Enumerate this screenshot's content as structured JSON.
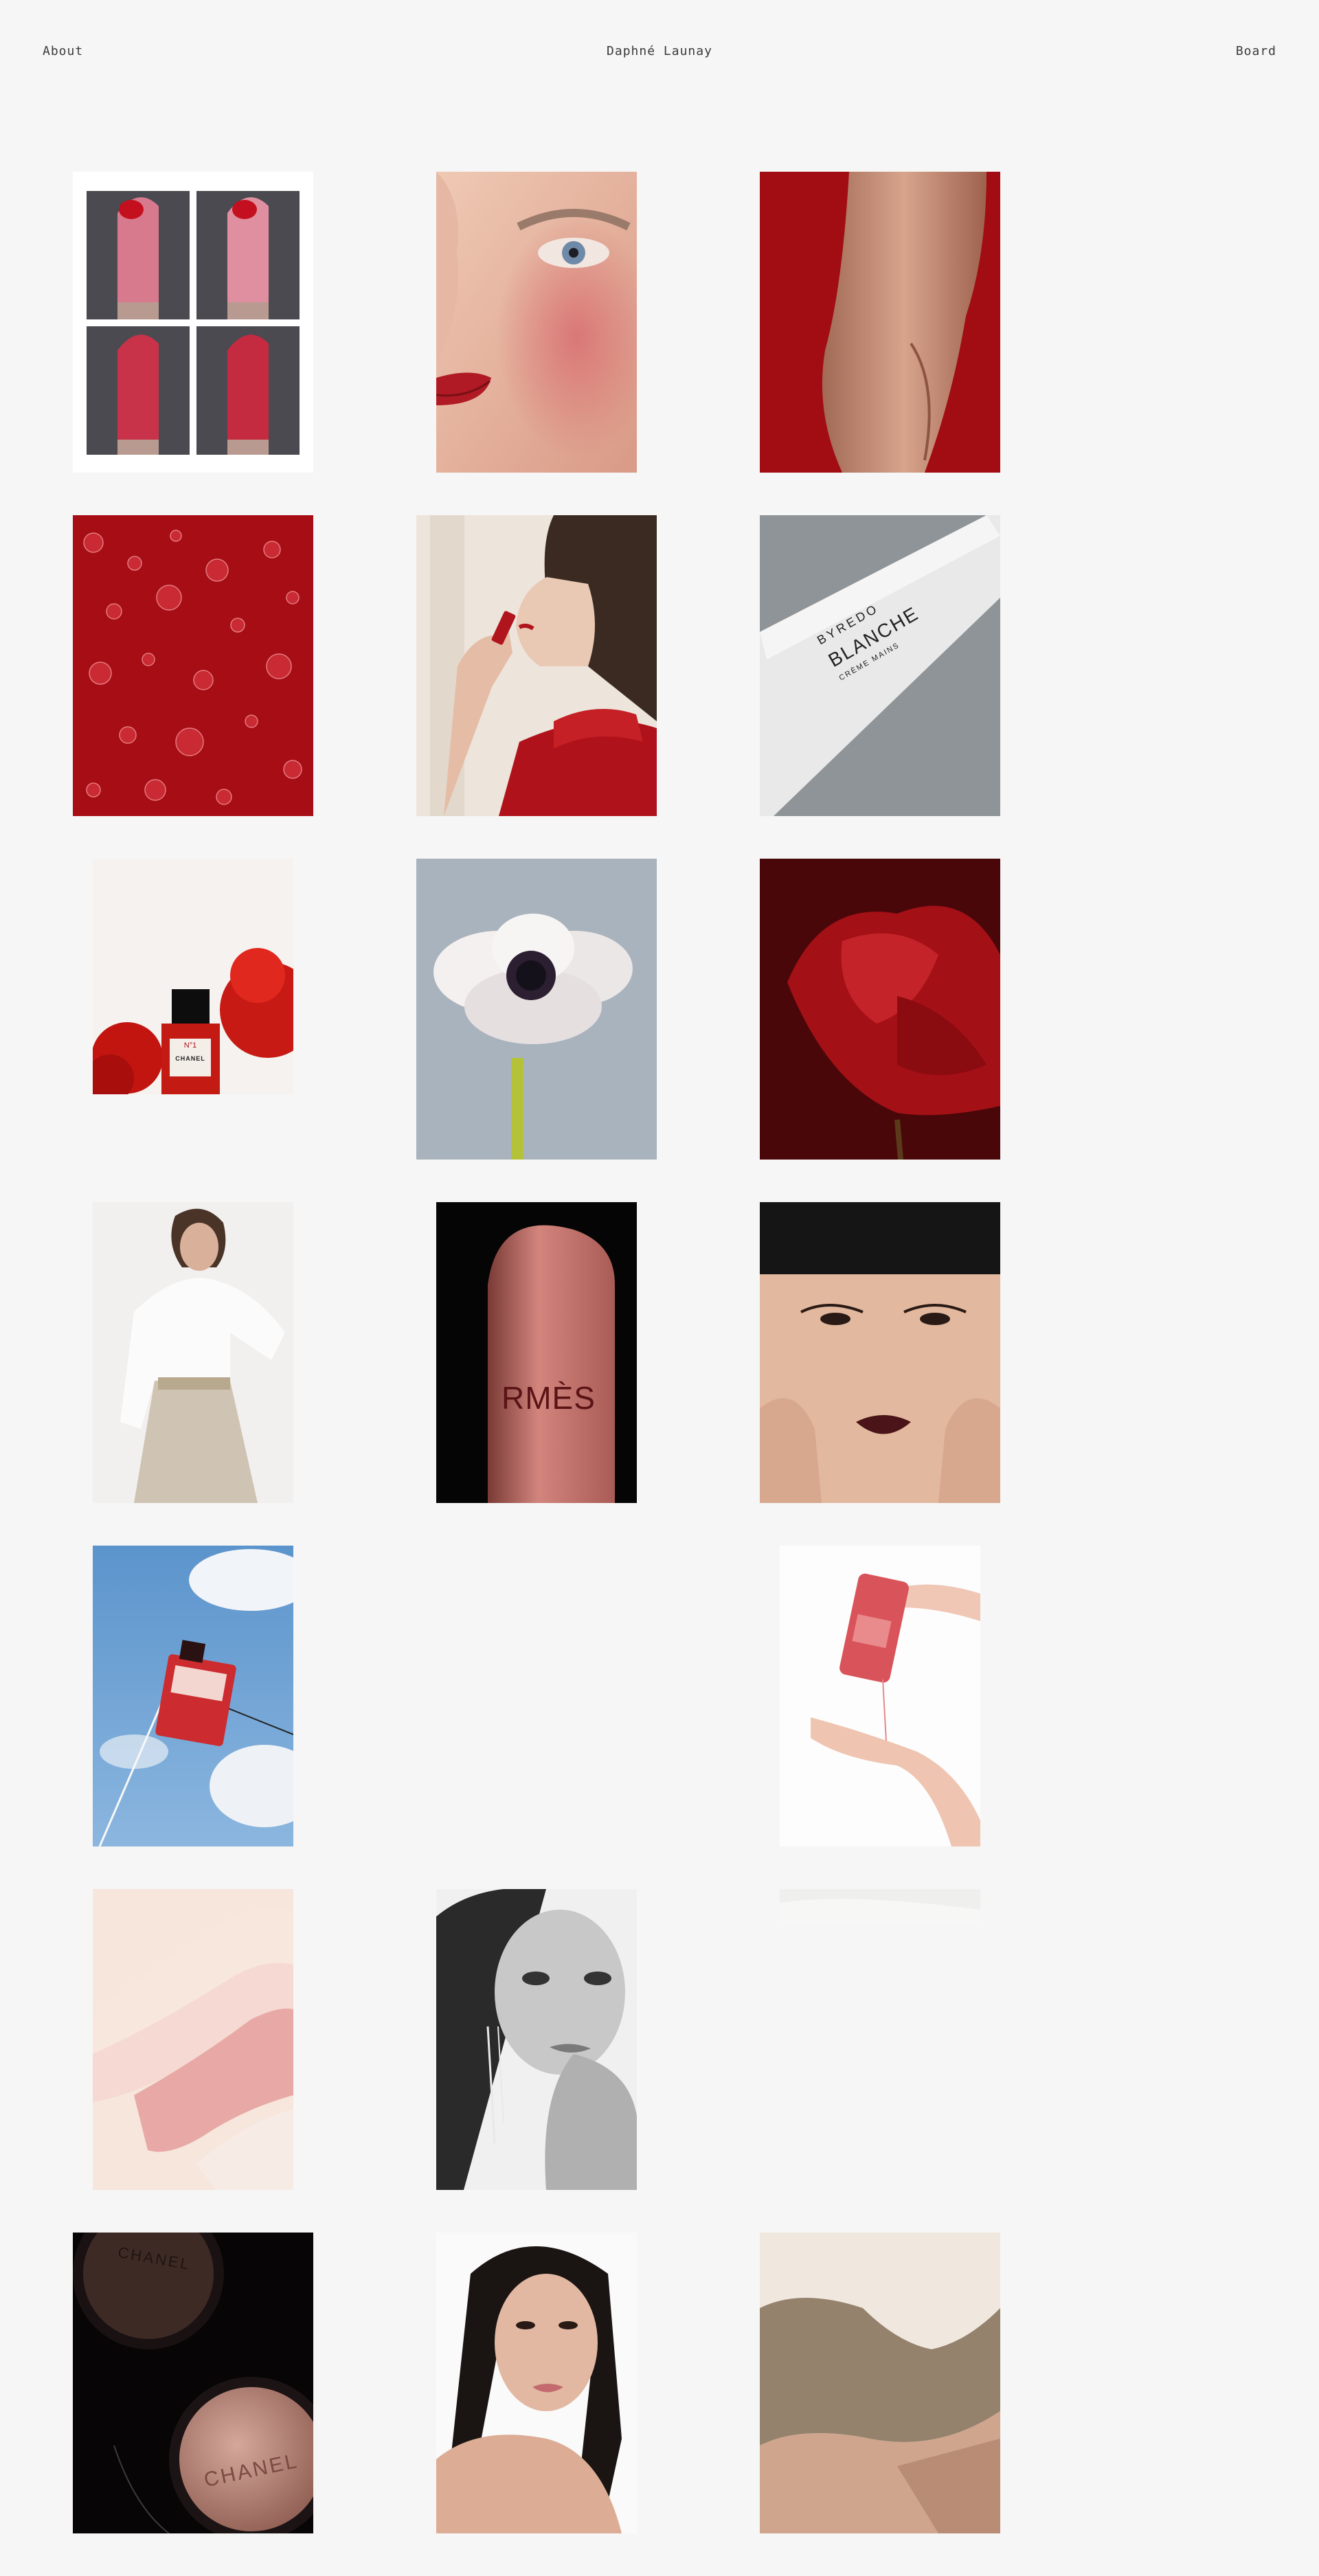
{
  "header": {
    "about_label": "About",
    "site_title": "Daphné Launay",
    "board_label": "Board"
  },
  "tiles": {
    "byredo": {
      "brand": "BYREDO",
      "product": "BLANCHE",
      "product_type": "CRÈME MAINS"
    },
    "chanel_bottle": {
      "number": "N°1",
      "brand": "CHANEL"
    },
    "hermes": {
      "brand": "RMÈS"
    },
    "chanel_highlighter": {
      "brand_top": "CHANEL",
      "brand_bottom": "CHANEL"
    }
  },
  "colors": {
    "background": "#f6f6f6",
    "accent_red": "#b0141c"
  }
}
